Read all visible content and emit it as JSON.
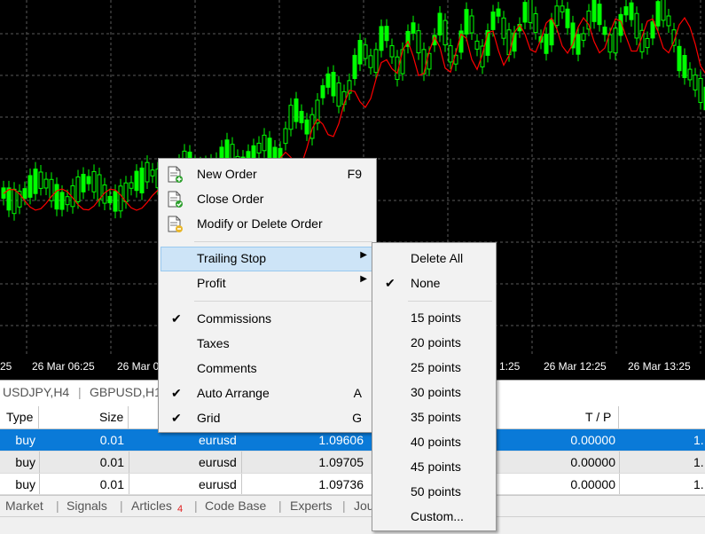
{
  "time_axis": [
    "25",
    "26 Mar 06:25",
    "26 Mar 0",
    "1:25",
    "26 Mar 12:25",
    "26 Mar 13:25"
  ],
  "symbol_tabs": [
    "USDJPY,H4",
    "GBPUSD,H1"
  ],
  "table": {
    "headers": [
      "Type",
      "Size",
      "",
      "",
      "",
      "T / P",
      ""
    ],
    "rows": [
      {
        "type": "buy",
        "size": "0.01",
        "symbol": "eurusd",
        "price": "1.09606",
        "tp": "0.00000",
        "extra": "1."
      },
      {
        "type": "buy",
        "size": "0.01",
        "symbol": "eurusd",
        "price": "1.09705",
        "tp": "0.00000",
        "extra": "1."
      },
      {
        "type": "buy",
        "size": "0.01",
        "symbol": "eurusd",
        "price": "1.09736",
        "tp": "0.00000",
        "extra": "1."
      }
    ]
  },
  "bottom_tabs": {
    "market": "Market",
    "signals": "Signals",
    "articles": "Articles",
    "articles_badge": "4",
    "code_base": "Code Base",
    "experts": "Experts",
    "journal": "Jou"
  },
  "context_menu": {
    "new_order": {
      "label": "New Order",
      "shortcut": "F9",
      "icon": "new-order-icon"
    },
    "close_order": {
      "label": "Close Order",
      "icon": "close-order-icon"
    },
    "modify_order": {
      "label": "Modify or Delete Order",
      "icon": "modify-order-icon"
    },
    "trailing_stop": {
      "label": "Trailing Stop"
    },
    "profit": {
      "label": "Profit"
    },
    "commissions": {
      "label": "Commissions",
      "checked": true
    },
    "taxes": {
      "label": "Taxes",
      "checked": false
    },
    "comments": {
      "label": "Comments",
      "checked": false
    },
    "auto_arrange": {
      "label": "Auto Arrange",
      "shortcut": "A",
      "checked": true
    },
    "grid": {
      "label": "Grid",
      "shortcut": "G",
      "checked": true
    },
    "submenu_arrow": "▶",
    "check_mark": "✔"
  },
  "trailing_submenu": {
    "delete_all": "Delete All",
    "none": "None",
    "none_checked": true,
    "p15": "15 points",
    "p20": "20 points",
    "p25": "25 points",
    "p30": "30 points",
    "p35": "35 points",
    "p40": "40 points",
    "p45": "45 points",
    "p50": "50 points",
    "custom": "Custom..."
  },
  "colors": {
    "chart_bg": "#000000",
    "candle": "#00ff00",
    "ma_line": "#ff0000",
    "grid": "#5a5a5a",
    "selected_row": "#0a7ad8",
    "menu_highlight": "#cde4f7"
  }
}
